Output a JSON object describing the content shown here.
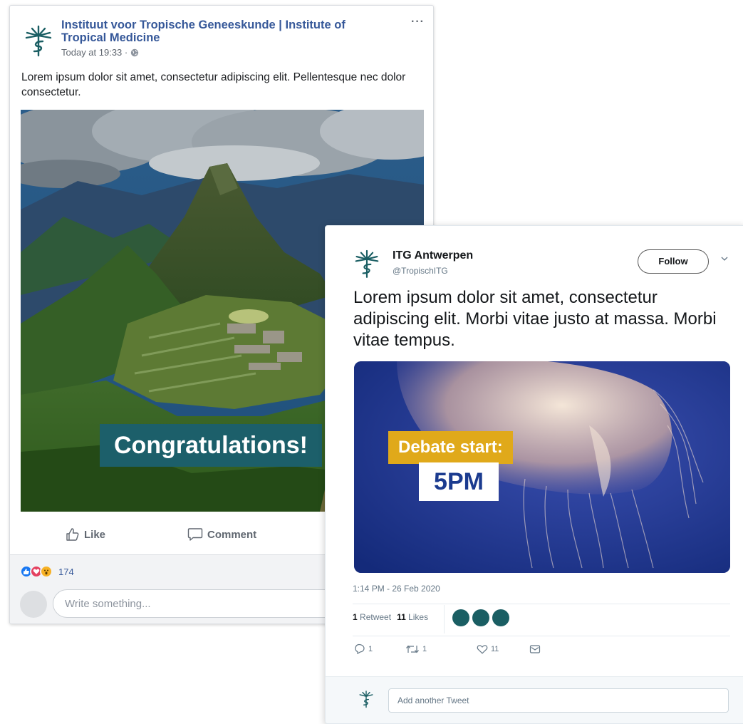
{
  "facebook": {
    "page_name": "Instituut voor Tropische Geneeskunde | Institute of Tropical Medicine",
    "timestamp": "Today at 19:33 ·",
    "more_label": "···",
    "post_text": "Lorem ipsum dolor sit amet, consectetur adipiscing elit. Pellentesque nec dolor consectetur.",
    "image_overlay_text": "Congratulations!",
    "actions": {
      "like": "Like",
      "comment": "Comment"
    },
    "reaction_count": "174",
    "comment_placeholder": "Write something...",
    "colors": {
      "link": "#365899",
      "overlay_bg": "#1c5f6a"
    }
  },
  "twitter": {
    "display_name": "ITG Antwerpen",
    "handle": "@TropischITG",
    "follow_label": "Follow",
    "tweet_text": "Lorem ipsum dolor sit amet, consectetur adipiscing elit. Morbi vitae justo at massa. Morbi vitae tempus.",
    "media_label_top": "Debate start:",
    "media_label_bottom": "5PM",
    "date": "1:14 PM - 26 Feb 2020",
    "retweets_count": "1",
    "retweets_label": "Retweet",
    "likes_count": "11",
    "likes_label": "Likes",
    "reply_count": "1",
    "retweet_action_count": "1",
    "like_action_count": "11",
    "reply_placeholder": "Add another Tweet",
    "colors": {
      "accent_box": "#e0a91a",
      "time_text": "#1b3b8f",
      "avatar": "#1a5e63"
    }
  }
}
